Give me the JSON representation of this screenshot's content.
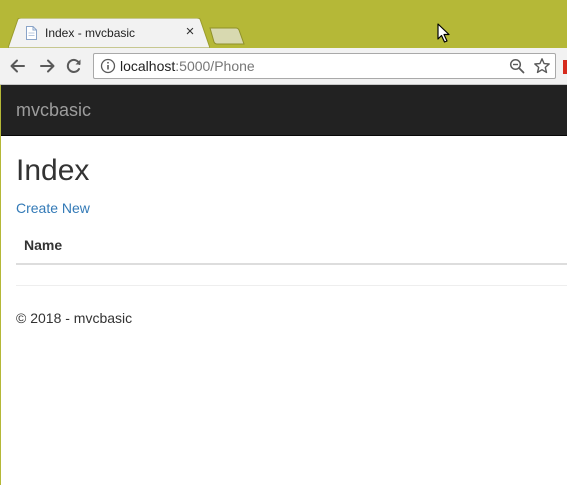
{
  "browser": {
    "tab": {
      "title": "Index - mvcbasic",
      "close_glyph": "×"
    },
    "address_bar": {
      "host": "localhost",
      "path": ":5000/Phone"
    }
  },
  "site": {
    "brand": "mvcbasic",
    "page_title": "Index",
    "create_link": "Create New",
    "table": {
      "columns": [
        "Name"
      ],
      "rows": []
    },
    "footer": "© 2018 - mvcbasic"
  },
  "colors": {
    "window_frame": "#b5b837",
    "navbar": "#222222",
    "brand_text": "#9d9d9d",
    "link": "#337ab7"
  }
}
